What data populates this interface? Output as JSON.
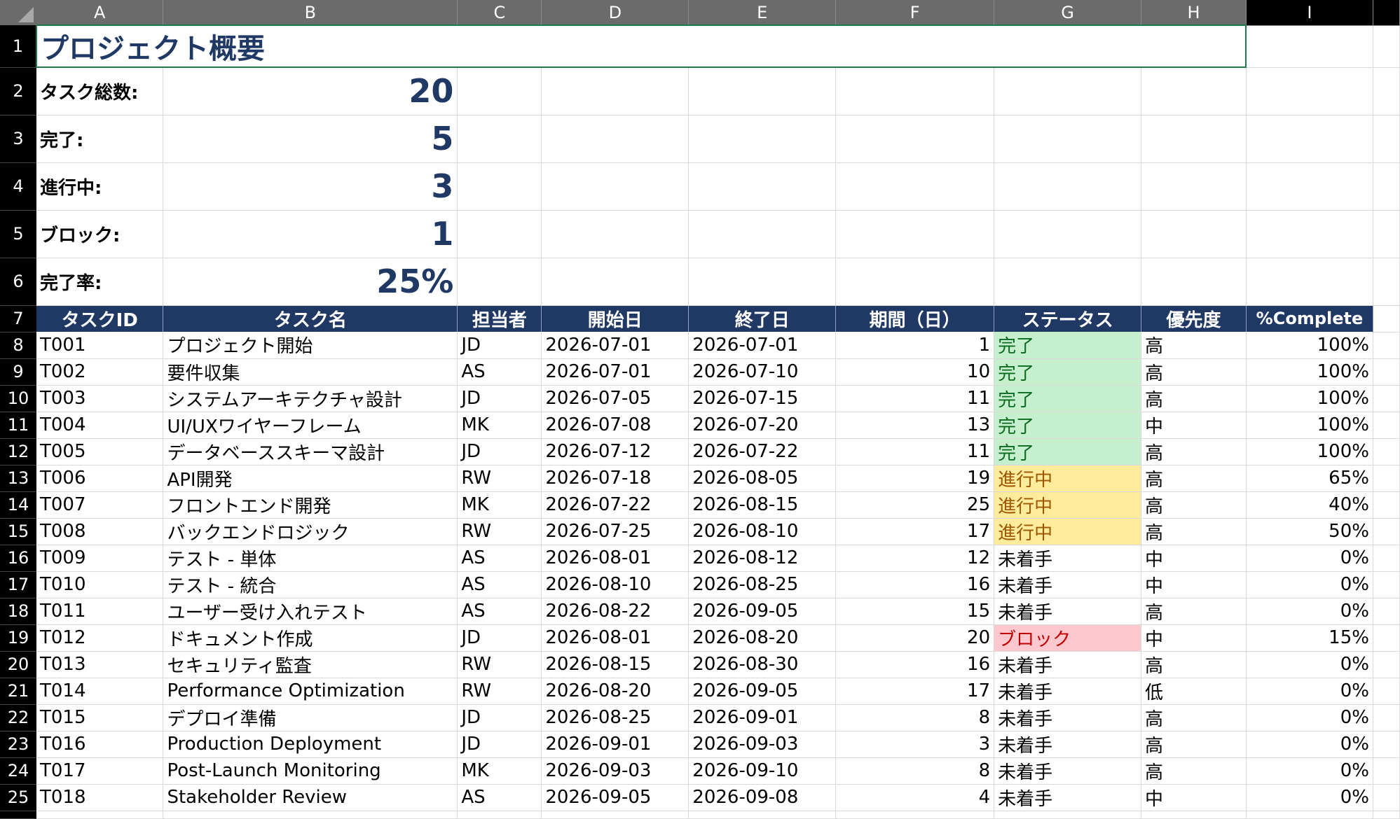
{
  "columns": [
    "A",
    "B",
    "C",
    "D",
    "E",
    "F",
    "G",
    "H",
    "I"
  ],
  "row_numbers": [
    "1",
    "2",
    "3",
    "4",
    "5",
    "6",
    "7",
    "8",
    "9",
    "10",
    "11",
    "12",
    "13",
    "14",
    "15",
    "16",
    "17",
    "18",
    "19",
    "20",
    "21",
    "22",
    "23",
    "24",
    "25"
  ],
  "summary": {
    "title": "プロジェクト概要",
    "total_label": "タスク総数:",
    "total_value": "20",
    "done_label": "完了:",
    "done_value": "5",
    "in_progress_label": "進行中:",
    "in_progress_value": "3",
    "blocked_label": "ブロック:",
    "blocked_value": "1",
    "completion_label": "完了率:",
    "completion_value": "25%"
  },
  "table": {
    "headers": [
      "タスクID",
      "タスク名",
      "担当者",
      "開始日",
      "終了日",
      "期間（日）",
      "ステータス",
      "優先度",
      "%Complete"
    ],
    "rows": [
      [
        "T001",
        "プロジェクト開始",
        "JD",
        "2026-07-01",
        "2026-07-01",
        "1",
        "完了",
        "高",
        "100%"
      ],
      [
        "T002",
        "要件収集",
        "AS",
        "2026-07-01",
        "2026-07-10",
        "10",
        "完了",
        "高",
        "100%"
      ],
      [
        "T003",
        "システムアーキテクチャ設計",
        "JD",
        "2026-07-05",
        "2026-07-15",
        "11",
        "完了",
        "高",
        "100%"
      ],
      [
        "T004",
        "UI/UXワイヤーフレーム",
        "MK",
        "2026-07-08",
        "2026-07-20",
        "13",
        "完了",
        "中",
        "100%"
      ],
      [
        "T005",
        "データベーススキーマ設計",
        "JD",
        "2026-07-12",
        "2026-07-22",
        "11",
        "完了",
        "高",
        "100%"
      ],
      [
        "T006",
        "API開発",
        "RW",
        "2026-07-18",
        "2026-08-05",
        "19",
        "進行中",
        "高",
        "65%"
      ],
      [
        "T007",
        "フロントエンド開発",
        "MK",
        "2026-07-22",
        "2026-08-15",
        "25",
        "進行中",
        "高",
        "40%"
      ],
      [
        "T008",
        "バックエンドロジック",
        "RW",
        "2026-07-25",
        "2026-08-10",
        "17",
        "進行中",
        "高",
        "50%"
      ],
      [
        "T009",
        "テスト - 単体",
        "AS",
        "2026-08-01",
        "2026-08-12",
        "12",
        "未着手",
        "中",
        "0%"
      ],
      [
        "T010",
        "テスト - 統合",
        "AS",
        "2026-08-10",
        "2026-08-25",
        "16",
        "未着手",
        "中",
        "0%"
      ],
      [
        "T011",
        "ユーザー受け入れテスト",
        "AS",
        "2026-08-22",
        "2026-09-05",
        "15",
        "未着手",
        "高",
        "0%"
      ],
      [
        "T012",
        "ドキュメント作成",
        "JD",
        "2026-08-01",
        "2026-08-20",
        "20",
        "ブロック",
        "中",
        "15%"
      ],
      [
        "T013",
        "セキュリティ監査",
        "RW",
        "2026-08-15",
        "2026-08-30",
        "16",
        "未着手",
        "高",
        "0%"
      ],
      [
        "T014",
        "Performance Optimization",
        "RW",
        "2026-08-20",
        "2026-09-05",
        "17",
        "未着手",
        "低",
        "0%"
      ],
      [
        "T015",
        "デプロイ準備",
        "JD",
        "2026-08-25",
        "2026-09-01",
        "8",
        "未着手",
        "高",
        "0%"
      ],
      [
        "T016",
        "Production Deployment",
        "JD",
        "2026-09-01",
        "2026-09-03",
        "3",
        "未着手",
        "高",
        "0%"
      ],
      [
        "T017",
        "Post-Launch Monitoring",
        "MK",
        "2026-09-03",
        "2026-09-10",
        "8",
        "未着手",
        "高",
        "0%"
      ],
      [
        "T018",
        "Stakeholder Review",
        "AS",
        "2026-09-05",
        "2026-09-08",
        "4",
        "未着手",
        "中",
        "0%"
      ]
    ]
  }
}
